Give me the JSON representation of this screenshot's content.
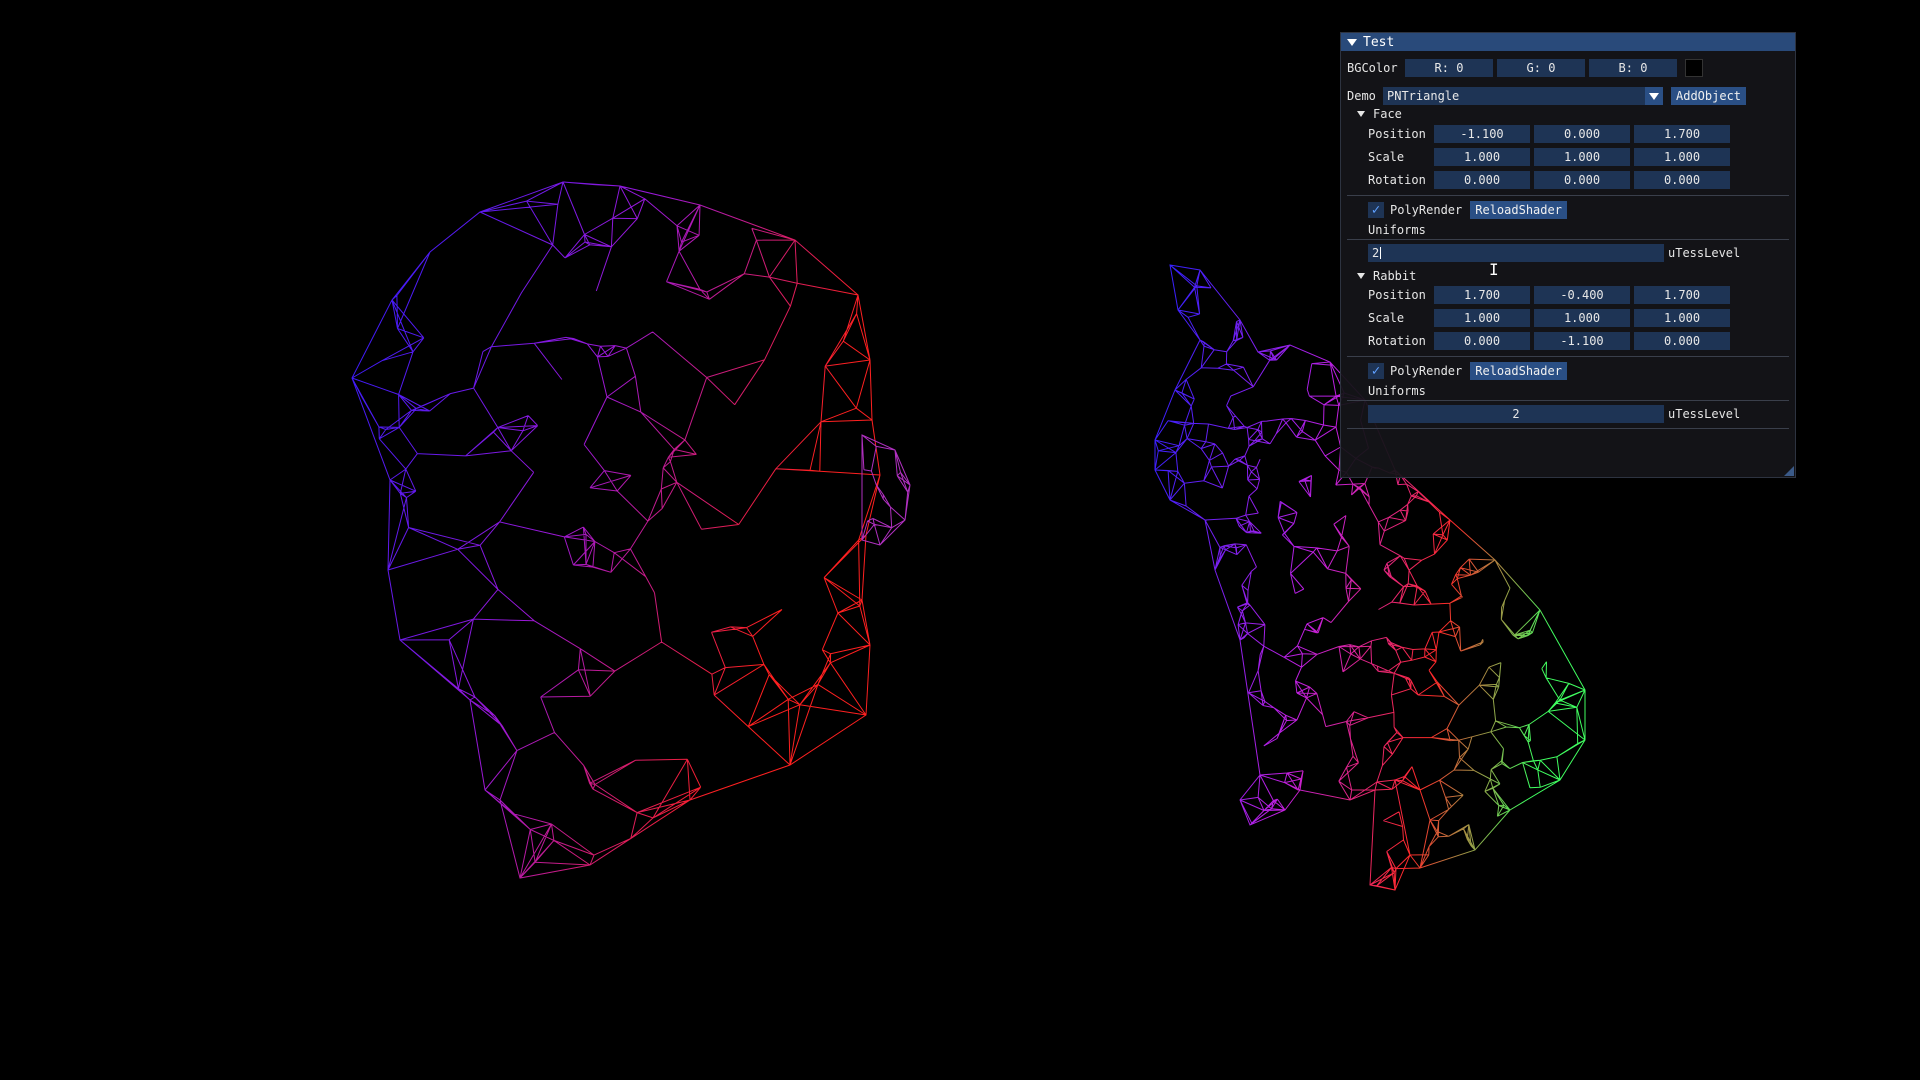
{
  "window": {
    "title": "Test",
    "bg_color": {
      "label": "BGColor",
      "r": "R:  0",
      "g": "G:  0",
      "b": "B:  0"
    },
    "demo": {
      "label": "Demo",
      "selected": "PNTriangle",
      "add_button": "AddObject"
    },
    "objects": [
      {
        "name": "Face",
        "position_label": "Position",
        "scale_label": "Scale",
        "rotation_label": "Rotation",
        "position": [
          "-1.100",
          "0.000",
          "1.700"
        ],
        "scale": [
          "1.000",
          "1.000",
          "1.000"
        ],
        "rotation": [
          "0.000",
          "0.000",
          "0.000"
        ],
        "poly_render_label": "PolyRender",
        "reload_label": "ReloadShader",
        "uniforms_label": "Uniforms",
        "tess_value": "2",
        "tess_label": "uTessLevel"
      },
      {
        "name": "Rabbit",
        "position_label": "Position",
        "scale_label": "Scale",
        "rotation_label": "Rotation",
        "position": [
          "1.700",
          "-0.400",
          "1.700"
        ],
        "scale": [
          "1.000",
          "1.000",
          "1.000"
        ],
        "rotation": [
          "0.000",
          "-1.100",
          "0.000"
        ],
        "poly_render_label": "PolyRender",
        "reload_label": "ReloadShader",
        "uniforms_label": "Uniforms",
        "tess_value": "2",
        "tess_label": "uTessLevel"
      }
    ]
  },
  "colors": {
    "title_bar": "#294a7a",
    "field_bg": "#1e3455",
    "button_bg": "#2a4f85",
    "check_mark": "#5fa0ff"
  }
}
